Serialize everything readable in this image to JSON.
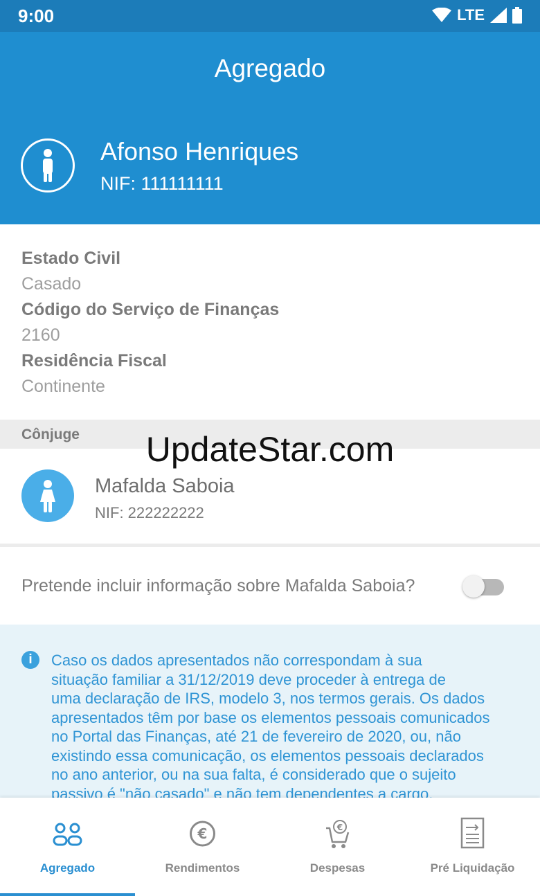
{
  "status_bar": {
    "time": "9:00",
    "network": "LTE"
  },
  "header": {
    "title": "Agregado"
  },
  "user": {
    "name": "Afonso Henriques",
    "nif": "NIF: 111111111"
  },
  "details": [
    {
      "label": "Estado Civil",
      "value": "Casado"
    },
    {
      "label": "Código do Serviço de Finanças",
      "value": "2160"
    },
    {
      "label": "Residência Fiscal",
      "value": "Continente"
    }
  ],
  "spouse_section": {
    "title": "Cônjuge"
  },
  "watermark": "UpdateStar.com",
  "spouse": {
    "name": "Mafalda Saboia",
    "nif": "NIF: 222222222"
  },
  "include_question": {
    "text": "Pretende incluir informação sobre Mafalda Saboia?",
    "enabled": false
  },
  "notice": {
    "lines": [
      "Caso os dados apresentados não correspondam à sua",
      "situação familiar a 31/12/2019 deve proceder à entrega de",
      "uma declaração de IRS, modelo 3, nos termos gerais. Os dados",
      "apresentados têm por base os elementos pessoais comunicados",
      "no Portal das Finanças, até 21 de fevereiro de 2020, ou, não",
      "existindo essa comunicação, os elementos pessoais declarados",
      "no ano anterior, ou na sua falta, é considerado que o sujeito",
      "passivo é \"não casado\" e não tem dependentes a cargo."
    ]
  },
  "tabs": [
    {
      "label": "Agregado",
      "icon": "people-icon",
      "active": true
    },
    {
      "label": "Rendimentos",
      "icon": "euro-coin-icon",
      "active": false
    },
    {
      "label": "Despesas",
      "icon": "euro-cart-icon",
      "active": false
    },
    {
      "label": "Pré Liquidação",
      "icon": "document-arrow-icon",
      "active": false
    }
  ],
  "colors": {
    "header_blue": "#1f8ed0",
    "status_blue": "#1c7cb9",
    "accent": "#2a8fd1",
    "notice_bg": "#e7f3f9",
    "spouse_avatar": "#4aaee8"
  }
}
